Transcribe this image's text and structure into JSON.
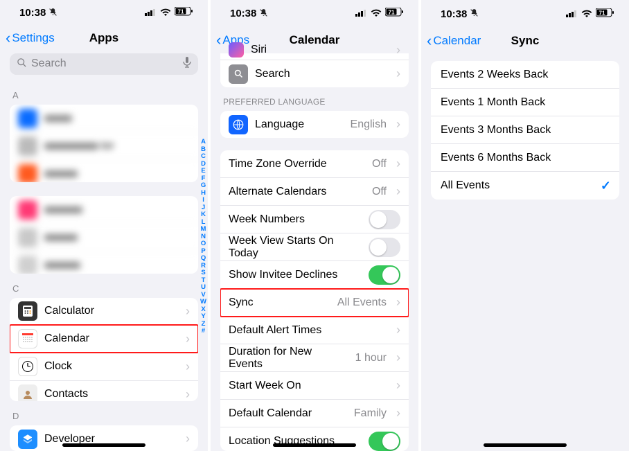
{
  "status": {
    "time": "10:38",
    "battery": "71"
  },
  "screen1": {
    "back": "Settings",
    "title": "Apps",
    "search_placeholder": "Search",
    "section_a": "A",
    "blur_unhidden": "tor",
    "section_c": "C",
    "apps_c": {
      "calculator": "Calculator",
      "calendar": "Calendar",
      "clock": "Clock",
      "contacts": "Contacts"
    },
    "section_d": "D",
    "apps_d": {
      "developer": "Developer"
    },
    "index": [
      "A",
      "B",
      "C",
      "D",
      "E",
      "F",
      "G",
      "H",
      "I",
      "J",
      "K",
      "L",
      "M",
      "N",
      "O",
      "P",
      "Q",
      "R",
      "S",
      "T",
      "U",
      "V",
      "W",
      "X",
      "Y",
      "Z",
      "#"
    ]
  },
  "screen2": {
    "back": "Apps",
    "title": "Calendar",
    "siri": "Siri",
    "search": "Search",
    "preferred_language_header": "PREFERRED LANGUAGE",
    "language_label": "Language",
    "language_value": "English",
    "tzo_label": "Time Zone Override",
    "tzo_value": "Off",
    "alt_label": "Alternate Calendars",
    "alt_value": "Off",
    "week_numbers": "Week Numbers",
    "week_view_today": "Week View Starts On Today",
    "invitee_declines": "Show Invitee Declines",
    "sync_label": "Sync",
    "sync_value": "All Events",
    "alert_times": "Default Alert Times",
    "duration_label": "Duration for New Events",
    "duration_value": "1 hour",
    "start_week": "Start Week On",
    "default_cal_label": "Default Calendar",
    "default_cal_value": "Family",
    "location_suggestions": "Location Suggestions"
  },
  "screen3": {
    "back": "Calendar",
    "title": "Sync",
    "options": {
      "w2": "Events 2 Weeks Back",
      "m1": "Events 1 Month Back",
      "m3": "Events 3 Months Back",
      "m6": "Events 6 Months Back",
      "all": "All Events"
    }
  }
}
